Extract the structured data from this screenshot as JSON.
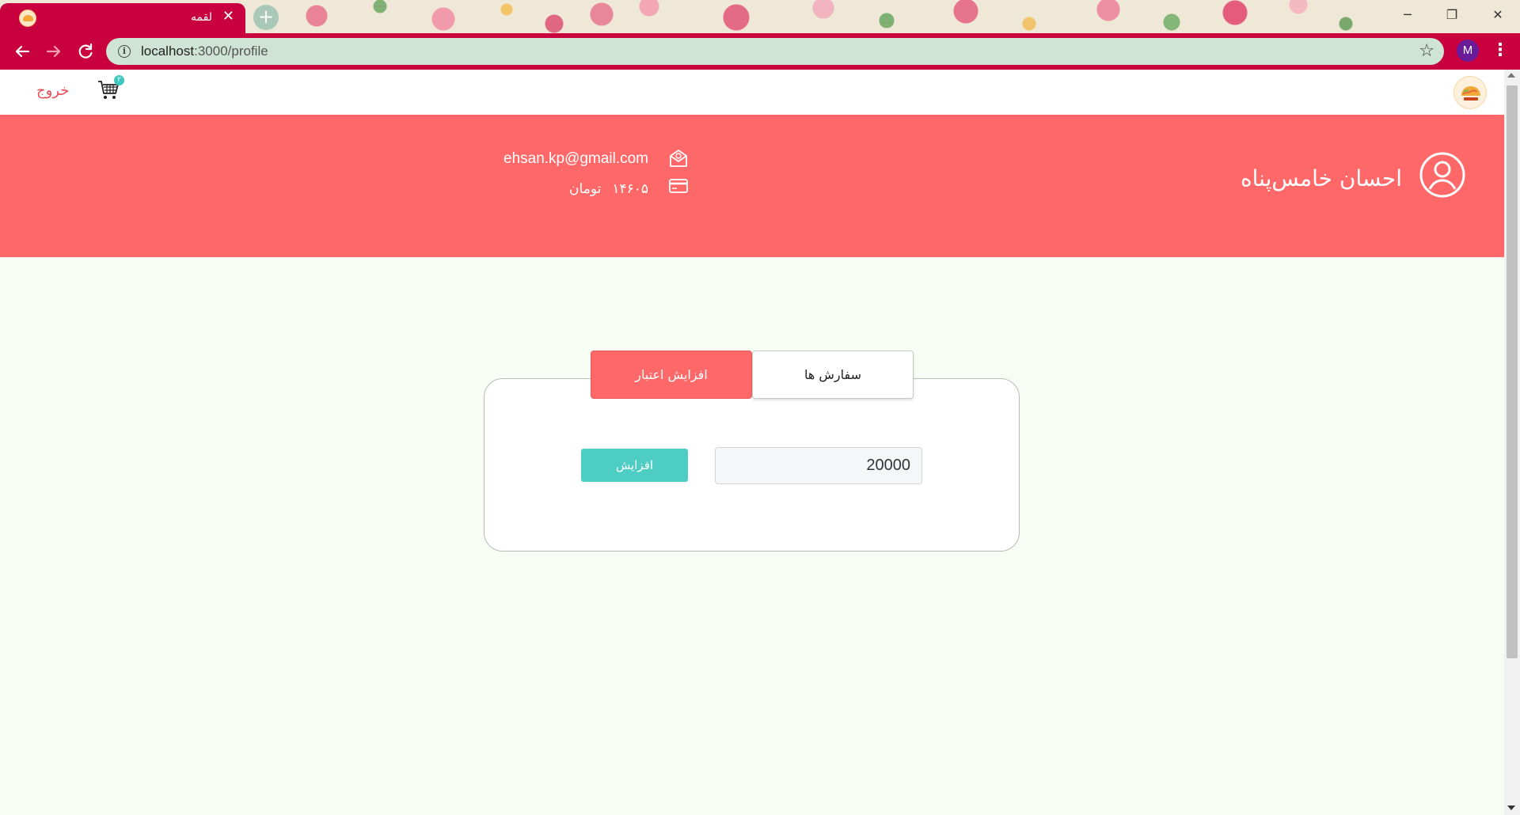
{
  "browser": {
    "tab_title": "لقمه",
    "tab_close": "✕",
    "new_tab": "+",
    "url_host": "localhost",
    "url_path": ":3000/profile",
    "profile_initial": "M",
    "window_minimize": "─",
    "window_restore": "❐",
    "window_close": "✕"
  },
  "navbar": {
    "logout_label": "خروج",
    "cart_count": "۲",
    "logo_icon": "logo-icon",
    "cart_icon": "cart-icon"
  },
  "profile": {
    "name": "احسان خامس‌پناه",
    "email": "ehsan.kp@gmail.com",
    "credit_amount": "۱۴۶۰۵",
    "credit_currency": "تومان",
    "avatar_icon": "user-circle-icon",
    "email_icon": "mail-icon",
    "credit_icon": "credit-card-icon"
  },
  "tabs": {
    "orders_label": "سفارش ها",
    "credit_label": "افزایش اعتبار",
    "active": "credit"
  },
  "credit_form": {
    "amount_value": "20000",
    "submit_label": "افزایش"
  },
  "colors": {
    "browser_accent": "#c8003f",
    "hero_bg": "#ff6868",
    "page_bg": "#f7fdf4",
    "button_teal": "#4ecdc4",
    "logout_red": "#e84d55"
  }
}
